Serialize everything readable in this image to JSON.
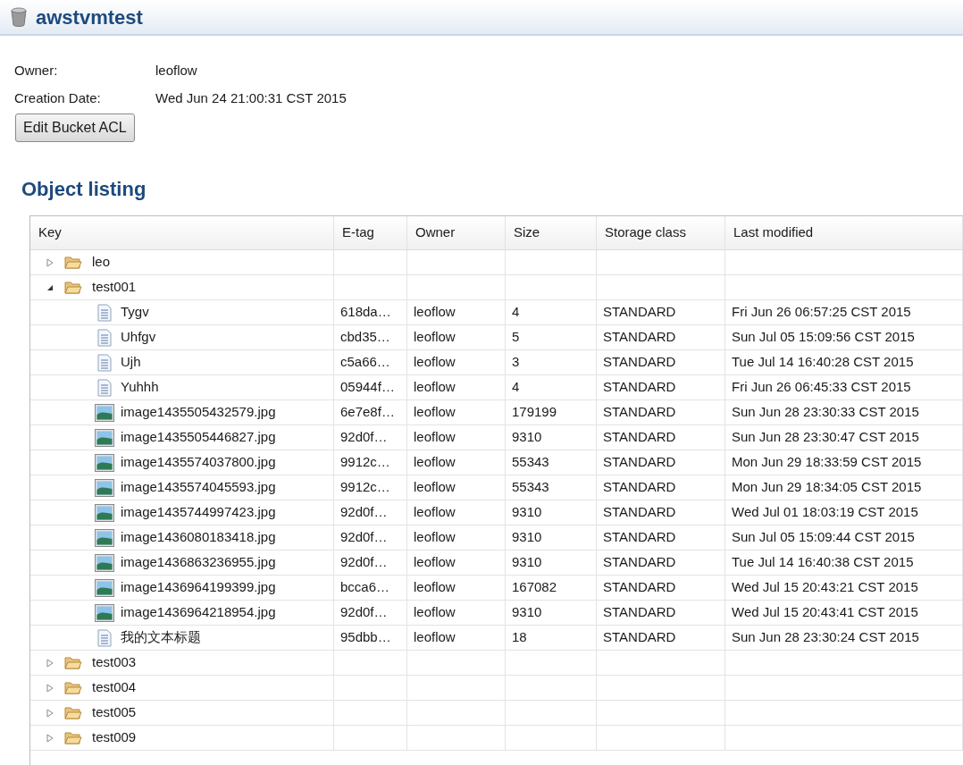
{
  "header": {
    "title": "awstvmtest"
  },
  "info": [
    {
      "label": "Owner:",
      "value": "leoflow"
    },
    {
      "label": "Creation Date:",
      "value": "Wed Jun 24 21:00:31 CST 2015"
    }
  ],
  "edit_button": "Edit Bucket ACL",
  "section_title": "Object listing",
  "table": {
    "columns": [
      "Key",
      "E-tag",
      "Owner",
      "Size",
      "Storage class",
      "Last modified"
    ],
    "rows": [
      {
        "kind": "folder",
        "key": "leo",
        "expanded": false
      },
      {
        "kind": "folder",
        "key": "test001",
        "expanded": true,
        "children": [
          {
            "kind": "text",
            "key": "Tygv",
            "etag": "618da…",
            "owner": "leoflow",
            "size": "4",
            "storage": "STANDARD",
            "modified": "Fri Jun 26 06:57:25 CST 2015"
          },
          {
            "kind": "text",
            "key": "Uhfgv",
            "etag": "cbd35…",
            "owner": "leoflow",
            "size": "5",
            "storage": "STANDARD",
            "modified": "Sun Jul 05 15:09:56 CST 2015"
          },
          {
            "kind": "text",
            "key": "Ujh",
            "etag": "c5a66…",
            "owner": "leoflow",
            "size": "3",
            "storage": "STANDARD",
            "modified": "Tue Jul 14 16:40:28 CST 2015"
          },
          {
            "kind": "text",
            "key": "Yuhhh",
            "etag": "05944f…",
            "owner": "leoflow",
            "size": "4",
            "storage": "STANDARD",
            "modified": "Fri Jun 26 06:45:33 CST 2015"
          },
          {
            "kind": "image",
            "key": "image1435505432579.jpg",
            "etag": "6e7e8f…",
            "owner": "leoflow",
            "size": "179199",
            "storage": "STANDARD",
            "modified": "Sun Jun 28 23:30:33 CST 2015"
          },
          {
            "kind": "image",
            "key": "image1435505446827.jpg",
            "etag": "92d0f…",
            "owner": "leoflow",
            "size": "9310",
            "storage": "STANDARD",
            "modified": "Sun Jun 28 23:30:47 CST 2015"
          },
          {
            "kind": "image",
            "key": "image1435574037800.jpg",
            "etag": "9912c…",
            "owner": "leoflow",
            "size": "55343",
            "storage": "STANDARD",
            "modified": "Mon Jun 29 18:33:59 CST 2015"
          },
          {
            "kind": "image",
            "key": "image1435574045593.jpg",
            "etag": "9912c…",
            "owner": "leoflow",
            "size": "55343",
            "storage": "STANDARD",
            "modified": "Mon Jun 29 18:34:05 CST 2015"
          },
          {
            "kind": "image",
            "key": "image1435744997423.jpg",
            "etag": "92d0f…",
            "owner": "leoflow",
            "size": "9310",
            "storage": "STANDARD",
            "modified": "Wed Jul 01 18:03:19 CST 2015"
          },
          {
            "kind": "image",
            "key": "image1436080183418.jpg",
            "etag": "92d0f…",
            "owner": "leoflow",
            "size": "9310",
            "storage": "STANDARD",
            "modified": "Sun Jul 05 15:09:44 CST 2015"
          },
          {
            "kind": "image",
            "key": "image1436863236955.jpg",
            "etag": "92d0f…",
            "owner": "leoflow",
            "size": "9310",
            "storage": "STANDARD",
            "modified": "Tue Jul 14 16:40:38 CST 2015"
          },
          {
            "kind": "image",
            "key": "image1436964199399.jpg",
            "etag": "bcca6…",
            "owner": "leoflow",
            "size": "167082",
            "storage": "STANDARD",
            "modified": "Wed Jul 15 20:43:21 CST 2015"
          },
          {
            "kind": "image",
            "key": "image1436964218954.jpg",
            "etag": "92d0f…",
            "owner": "leoflow",
            "size": "9310",
            "storage": "STANDARD",
            "modified": "Wed Jul 15 20:43:41 CST 2015"
          },
          {
            "kind": "text",
            "key": "我的文本标题",
            "etag": "95dbb…",
            "owner": "leoflow",
            "size": "18",
            "storage": "STANDARD",
            "modified": "Sun Jun 28 23:30:24 CST 2015"
          }
        ]
      },
      {
        "kind": "folder",
        "key": "test003",
        "expanded": false
      },
      {
        "kind": "folder",
        "key": "test004",
        "expanded": false
      },
      {
        "kind": "folder",
        "key": "test005",
        "expanded": false
      },
      {
        "kind": "folder",
        "key": "test009",
        "expanded": false
      }
    ]
  }
}
